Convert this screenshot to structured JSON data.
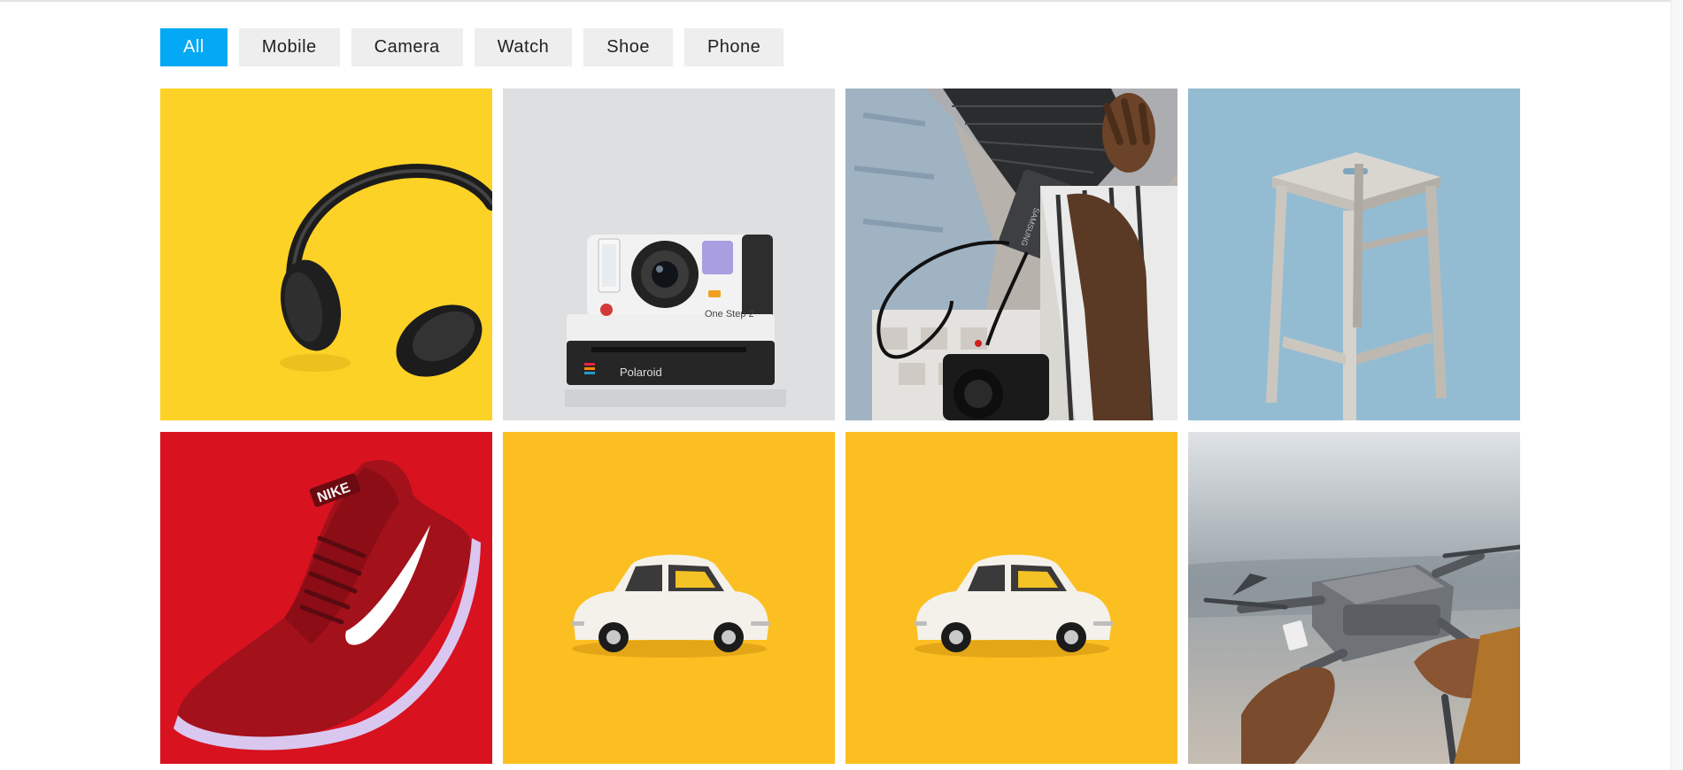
{
  "filters": [
    {
      "label": "All",
      "active": true
    },
    {
      "label": "Mobile",
      "active": false
    },
    {
      "label": "Camera",
      "active": false
    },
    {
      "label": "Watch",
      "active": false
    },
    {
      "label": "Shoe",
      "active": false
    },
    {
      "label": "Phone",
      "active": false
    }
  ],
  "gallery": {
    "items": [
      {
        "subject": "headphones",
        "background": "#fdd226"
      },
      {
        "subject": "instant-camera",
        "background": "#dedfe1",
        "brand_text": "Polaroid",
        "model_text": "One Step 2"
      },
      {
        "subject": "laptop-ssd",
        "background": "#8a8a86",
        "brand_text": "SAMSUNG"
      },
      {
        "subject": "wooden-stool",
        "background": "#93bcd3"
      },
      {
        "subject": "sneaker",
        "background": "#d8121f",
        "brand_text": "NIKE"
      },
      {
        "subject": "toy-car",
        "background": "#fcbf22"
      },
      {
        "subject": "toy-car",
        "background": "#fcbf22"
      },
      {
        "subject": "drone",
        "background": "#a9aeb2"
      }
    ]
  }
}
